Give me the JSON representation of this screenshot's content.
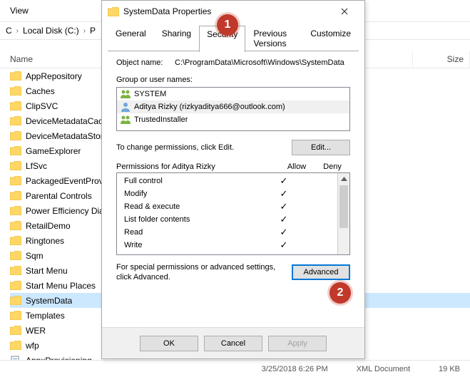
{
  "explorer": {
    "view_label": "View",
    "breadcrumb": [
      "C",
      "Local Disk (C:)",
      "P"
    ],
    "headers": {
      "name": "Name",
      "date": "",
      "type": "",
      "size": "Size"
    },
    "items": [
      {
        "name": "AppRepository",
        "type": "folder"
      },
      {
        "name": "Caches",
        "type": "folder"
      },
      {
        "name": "ClipSVC",
        "type": "folder"
      },
      {
        "name": "DeviceMetadataCache",
        "type": "folder"
      },
      {
        "name": "DeviceMetadataStore",
        "type": "folder"
      },
      {
        "name": "GameExplorer",
        "type": "folder"
      },
      {
        "name": "LfSvc",
        "type": "folder"
      },
      {
        "name": "PackagedEventProvid",
        "type": "folder"
      },
      {
        "name": "Parental Controls",
        "type": "folder"
      },
      {
        "name": "Power Efficiency Diag",
        "type": "folder"
      },
      {
        "name": "RetailDemo",
        "type": "folder"
      },
      {
        "name": "Ringtones",
        "type": "folder"
      },
      {
        "name": "Sqm",
        "type": "folder"
      },
      {
        "name": "Start Menu",
        "type": "folder"
      },
      {
        "name": "Start Menu Places",
        "type": "folder"
      },
      {
        "name": "SystemData",
        "type": "folder",
        "selected": true
      },
      {
        "name": "Templates",
        "type": "folder"
      },
      {
        "name": "WER",
        "type": "folder"
      },
      {
        "name": "wfp",
        "type": "folder"
      },
      {
        "name": "AppxProvisioning",
        "type": "file"
      }
    ],
    "status_detail": {
      "date": "3/25/2018 6:26 PM",
      "type": "XML Document",
      "size": "19 KB"
    }
  },
  "dialog": {
    "title": "SystemData Properties",
    "tabs": [
      "General",
      "Sharing",
      "Security",
      "Previous Versions",
      "Customize"
    ],
    "active_tab": "Security",
    "object_label": "Object name:",
    "object_path": "C:\\ProgramData\\Microsoft\\Windows\\SystemData",
    "groups_label": "Group or user names:",
    "groups": [
      {
        "name": "SYSTEM",
        "icon": "group"
      },
      {
        "name": "Aditya Rizky (rizkyaditya666@outlook.com)",
        "icon": "user",
        "selected": true
      },
      {
        "name": "TrustedInstaller",
        "icon": "group"
      }
    ],
    "edit_hint": "To change permissions, click Edit.",
    "edit_btn": "Edit...",
    "perm_label": "Permissions for Aditya Rizky",
    "allow": "Allow",
    "deny": "Deny",
    "permissions": [
      {
        "name": "Full control",
        "allow": true
      },
      {
        "name": "Modify",
        "allow": true
      },
      {
        "name": "Read & execute",
        "allow": true
      },
      {
        "name": "List folder contents",
        "allow": true
      },
      {
        "name": "Read",
        "allow": true
      },
      {
        "name": "Write",
        "allow": true
      }
    ],
    "adv_hint": "For special permissions or advanced settings, click Advanced.",
    "adv_btn": "Advanced",
    "ok": "OK",
    "cancel": "Cancel",
    "apply": "Apply"
  },
  "callouts": {
    "1": "1",
    "2": "2"
  }
}
